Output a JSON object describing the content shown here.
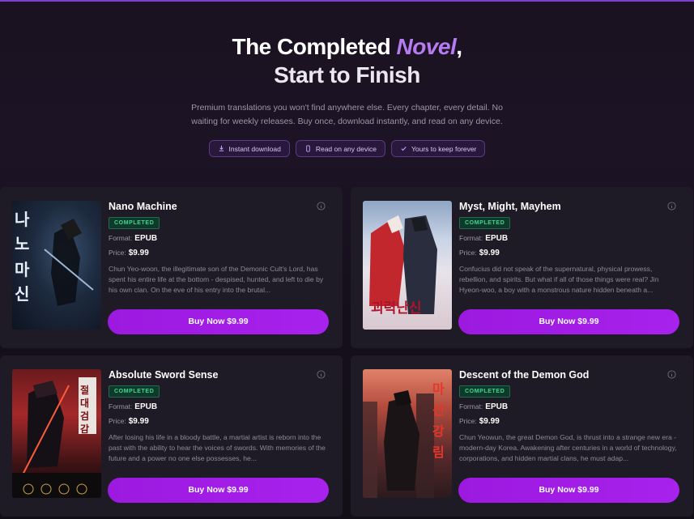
{
  "hero": {
    "title_part1": "The Completed ",
    "title_accent": "Novel",
    "title_comma": ",",
    "title_line2": "Start to Finish",
    "subtitle": "Premium translations you won't find anywhere else. Every chapter, every detail. No waiting for weekly releases. Buy once, download instantly, and read on any device.",
    "pills": [
      {
        "label": "Instant download",
        "icon": "download-icon"
      },
      {
        "label": "Read on any device",
        "icon": "phone-icon"
      },
      {
        "label": "Yours to keep forever",
        "icon": "check-icon"
      }
    ]
  },
  "labels": {
    "format": "Format:",
    "price": "Price:"
  },
  "books": [
    {
      "title": "Nano Machine",
      "status": "COMPLETED",
      "format": "EPUB",
      "price": "$9.99",
      "description": "Chun Yeo-woon, the illegitimate son of the Demonic Cult's Lord, has spent his entire life at the bottom - despised, hunted, and left to die by his own clan. On the eve of his entry into the brutal...",
      "buy_label": "Buy Now $9.99",
      "cover_text": "나노마신"
    },
    {
      "title": "Myst, Might, Mayhem",
      "status": "COMPLETED",
      "format": "EPUB",
      "price": "$9.99",
      "description": "Confucius did not speak of the supernatural, physical prowess, rebellion, and spirits. But what if all of those things were real? Jin Hyeon-woo, a boy with a monstrous nature hidden beneath a...",
      "buy_label": "Buy Now $9.99",
      "cover_text": "괴력난신"
    },
    {
      "title": "Absolute Sword Sense",
      "status": "COMPLETED",
      "format": "EPUB",
      "price": "$9.99",
      "description": "After losing his life in a bloody battle, a martial artist is reborn into the past with the ability to hear the voices of swords. With memories of the future and a power no one else possesses, he...",
      "buy_label": "Buy Now $9.99",
      "cover_text": "절대검감"
    },
    {
      "title": "Descent of the Demon God",
      "status": "COMPLETED",
      "format": "EPUB",
      "price": "$9.99",
      "description": "Chun Yeowun, the great Demon God, is thrust into a strange new era - modern-day Korea. Awakening after centuries in a world of technology, corporations, and hidden martial clans, he must adap...",
      "buy_label": "Buy Now $9.99",
      "cover_text": "마신강림"
    }
  ],
  "colors": {
    "accent": "#b57cf2",
    "buy_button": "#a01ce4",
    "badge_text": "#3fd98f",
    "card_bg": "#1f1b26"
  }
}
